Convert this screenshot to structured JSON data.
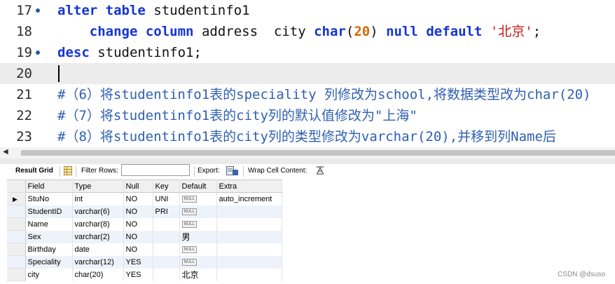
{
  "editor": {
    "lines": [
      {
        "num": "17",
        "marker": true,
        "tokens": [
          {
            "t": "alter",
            "c": "kw"
          },
          {
            "t": " "
          },
          {
            "t": "table",
            "c": "kw"
          },
          {
            "t": " studentinfo1"
          }
        ]
      },
      {
        "num": "18",
        "marker": false,
        "tokens": [
          {
            "t": "    "
          },
          {
            "t": "change",
            "c": "kw"
          },
          {
            "t": " "
          },
          {
            "t": "column",
            "c": "kw"
          },
          {
            "t": " address  city "
          },
          {
            "t": "char",
            "c": "kw"
          },
          {
            "t": "("
          },
          {
            "t": "20",
            "c": "num"
          },
          {
            "t": ") "
          },
          {
            "t": "null",
            "c": "kw"
          },
          {
            "t": " "
          },
          {
            "t": "default",
            "c": "kw"
          },
          {
            "t": " "
          },
          {
            "t": "'北京'",
            "c": "str"
          },
          {
            "t": ";"
          }
        ]
      },
      {
        "num": "19",
        "marker": true,
        "tokens": [
          {
            "t": "desc",
            "c": "kw"
          },
          {
            "t": " studentinfo1;"
          }
        ]
      },
      {
        "num": "20",
        "marker": false,
        "current": true,
        "tokens": []
      },
      {
        "num": "21",
        "marker": false,
        "tokens": [
          {
            "t": "#（6）将studentinfo1表的speciality 列修改为school,将数据类型改为char(20)",
            "c": "cmt"
          }
        ]
      },
      {
        "num": "22",
        "marker": false,
        "tokens": [
          {
            "t": "#（7）将studentinfo1表的city列的默认值修改为\"上海\"",
            "c": "cmt"
          }
        ]
      },
      {
        "num": "23",
        "marker": false,
        "tokens": [
          {
            "t": "#（8）将studentinfo1表的city列的类型修改为varchar(20),并移到列Name后",
            "c": "cmt"
          }
        ]
      }
    ]
  },
  "toolbar": {
    "result_grid": "Result Grid",
    "filter_rows": "Filter Rows:",
    "filter_value": "",
    "export": "Export:",
    "wrap": "Wrap Cell Content:"
  },
  "grid": {
    "columns": [
      "Field",
      "Type",
      "Null",
      "Key",
      "Default",
      "Extra"
    ],
    "rows": [
      {
        "selected": true,
        "cells": [
          "StuNo",
          "int",
          "NO",
          "UNI",
          {
            "null": "NULL"
          },
          "auto_increment"
        ]
      },
      {
        "cells": [
          "StudentID",
          "varchar(6)",
          "NO",
          "PRI",
          {
            "null": "NULL"
          },
          ""
        ]
      },
      {
        "cells": [
          "Name",
          "varchar(8)",
          "NO",
          "",
          {
            "null": "NULL"
          },
          ""
        ]
      },
      {
        "cells": [
          "Sex",
          "varchar(2)",
          "NO",
          "",
          "男",
          ""
        ]
      },
      {
        "cells": [
          "Birthday",
          "date",
          "NO",
          "",
          {
            "null": "NULL"
          },
          ""
        ]
      },
      {
        "cells": [
          "Speciality",
          "varchar(12)",
          "YES",
          "",
          {
            "null": "NULL"
          },
          ""
        ]
      },
      {
        "cells": [
          "city",
          "char(20)",
          "YES",
          "",
          "北京",
          ""
        ]
      }
    ]
  },
  "watermark": "CSDN @dsuso",
  "colors": {
    "keyword": "#1535d1",
    "number": "#d16a00",
    "string": "#c41a16",
    "comment": "#2f5fb3",
    "marker": "#1f5fa8"
  }
}
